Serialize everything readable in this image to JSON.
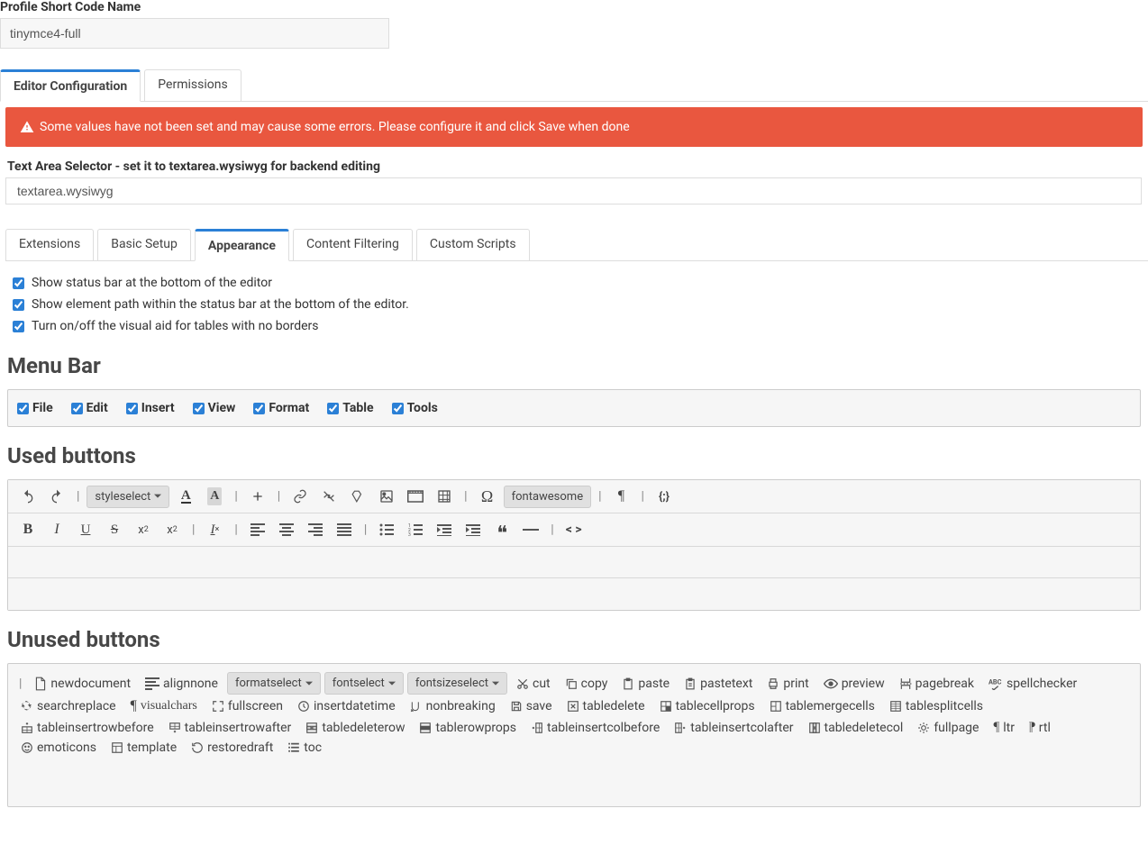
{
  "field_label": "Profile Short Code Name",
  "profile_value": "tinymce4-full",
  "main_tabs": {
    "editor_config": "Editor Configuration",
    "permissions": "Permissions"
  },
  "alert": "Some values have not been set and may cause some errors. Please configure it and click Save when done",
  "selector_label": "Text Area Selector - set it to textarea.wysiwyg for backend editing",
  "selector_value": "textarea.wysiwyg",
  "sub_tabs": {
    "ext": "Extensions",
    "basic": "Basic Setup",
    "appearance": "Appearance",
    "filter": "Content Filtering",
    "custom": "Custom Scripts"
  },
  "checks": {
    "status_bar": "Show status bar at the bottom of the editor",
    "elem_path": "Show element path within the status bar at the bottom of the editor.",
    "visual_aid": "Turn on/off the visual aid for tables with no borders"
  },
  "section_menubar": "Menu Bar",
  "menubar": {
    "file": "File",
    "edit": "Edit",
    "insert": "Insert",
    "view": "View",
    "format": "Format",
    "table": "Table",
    "tools": "Tools"
  },
  "section_used": "Used buttons",
  "toolbar": {
    "styleselect": "styleselect",
    "fontawesome": "fontawesome"
  },
  "section_unused": "Unused buttons",
  "unused": {
    "newdocument": "newdocument",
    "alignnone": "alignnone",
    "formatselect": "formatselect",
    "fontselect": "fontselect",
    "fontsizeselect": "fontsizeselect",
    "cut": "cut",
    "copy": "copy",
    "paste": "paste",
    "pastetext": "pastetext",
    "print": "print",
    "preview": "preview",
    "pagebreak": "pagebreak",
    "spellchecker": "spellchecker",
    "searchreplace": "searchreplace",
    "visualchars": "visualchars",
    "fullscreen": "fullscreen",
    "insertdatetime": "insertdatetime",
    "nonbreaking": "nonbreaking",
    "save": "save",
    "tabledelete": "tabledelete",
    "tablecellprops": "tablecellprops",
    "tablemergecells": "tablemergecells",
    "tablesplitcells": "tablesplitcells",
    "tableinsertrowbefore": "tableinsertrowbefore",
    "tableinsertrowafter": "tableinsertrowafter",
    "tabledeleterow": "tabledeleterow",
    "tablerowprops": "tablerowprops",
    "tableinsertcolbefore": "tableinsertcolbefore",
    "tableinsertcolafter": "tableinsertcolafter",
    "tabledeletecol": "tabledeletecol",
    "fullpage": "fullpage",
    "ltr": "ltr",
    "rtl": "rtl",
    "emoticons": "emoticons",
    "template": "template",
    "restoredraft": "restoredraft",
    "toc": "toc"
  }
}
